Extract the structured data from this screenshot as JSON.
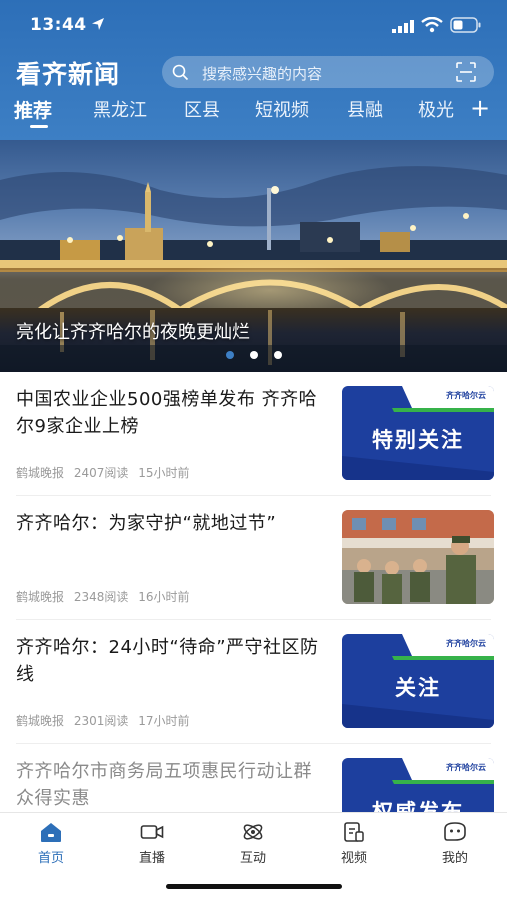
{
  "status_bar": {
    "time": "13:44",
    "icons": [
      "location-arrow-icon",
      "signal-icon",
      "wifi-icon",
      "battery-icon"
    ]
  },
  "header": {
    "logo": "看齐新闻",
    "search_placeholder": "搜索感兴趣的内容",
    "search_icon": "search-icon",
    "scan_icon": "scan-icon",
    "tabs": [
      {
        "label": "推荐",
        "active": true
      },
      {
        "label": "黑龙江",
        "active": false
      },
      {
        "label": "区县",
        "active": false
      },
      {
        "label": "短视频",
        "active": false
      },
      {
        "label": "县融",
        "active": false
      },
      {
        "label": "极光",
        "active": false
      }
    ],
    "add_tab_label": "+",
    "accent_color": "#2d6fb8"
  },
  "banner": {
    "caption": "亮化让齐齐哈尔的夜晚更灿烂",
    "dots": 3,
    "active_dot": 0
  },
  "news": [
    {
      "title": "中国农业企业500强榜单发布 齐齐哈尔9家企业上榜",
      "source": "鹤城晚报",
      "reads": "2407阅读",
      "time": "15小时前",
      "thumb_label": "特别关注",
      "thumb_brand": "齐齐哈尔云"
    },
    {
      "title": "齐齐哈尔：为家守护“就地过节”",
      "source": "鹤城晚报",
      "reads": "2348阅读",
      "time": "16小时前",
      "thumb_label": "",
      "thumb_brand": ""
    },
    {
      "title": "齐齐哈尔：24小时“待命”严守社区防线",
      "source": "鹤城晚报",
      "reads": "2301阅读",
      "time": "17小时前",
      "thumb_label": "关注",
      "thumb_brand": "齐齐哈尔云"
    },
    {
      "title": "齐齐哈尔市商务局五项惠民行动让群众得实惠",
      "source": "",
      "reads": "",
      "time": "",
      "thumb_label": "权威发布",
      "thumb_brand": "齐齐哈尔云"
    }
  ],
  "bottom_nav": [
    {
      "label": "首页",
      "icon": "home-icon",
      "active": true
    },
    {
      "label": "直播",
      "icon": "live-camera-icon",
      "active": false
    },
    {
      "label": "互动",
      "icon": "interact-icon",
      "active": false
    },
    {
      "label": "视频",
      "icon": "video-doc-icon",
      "active": false
    },
    {
      "label": "我的",
      "icon": "profile-icon",
      "active": false
    }
  ]
}
